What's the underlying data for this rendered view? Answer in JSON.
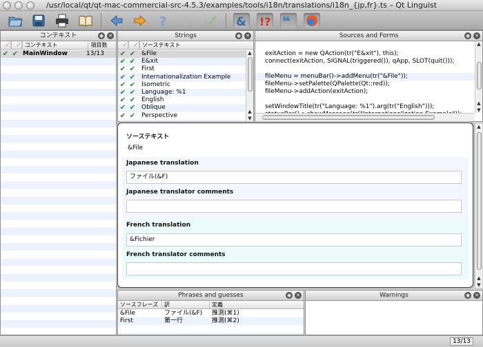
{
  "window": {
    "title": "/usr/local/qt/qt-mac-commercial-src-4.5.3/examples/tools/i18n/translations/i18n_{jp,fr}.ts – Qt Linguist"
  },
  "toolbar": {
    "icons": [
      "open-icon",
      "save-icon",
      "print-icon",
      "phrasebook-icon",
      "previous-icon",
      "next-icon",
      "prev-unfinished-icon",
      "next-unfinished-icon",
      "done-next-icon",
      "accelerators-icon",
      "ending-punctuation-icon",
      "phrase-matches-icon",
      "place-marker-icon"
    ]
  },
  "context_panel": {
    "title": "コンテキスト",
    "columns": [
      "",
      "コンテキスト",
      "項目数"
    ],
    "rows": [
      {
        "name": "MainWindow",
        "count": "13/13"
      }
    ]
  },
  "strings_panel": {
    "title": "Strings",
    "columns": [
      "",
      "ソーステキスト"
    ],
    "rows": [
      {
        "text": "&File",
        "selected": true
      },
      {
        "text": "E&xit"
      },
      {
        "text": "First"
      },
      {
        "text": "Internationalization Example"
      },
      {
        "text": "Isometric"
      },
      {
        "text": "Language: %1"
      },
      {
        "text": "English"
      },
      {
        "text": "Oblique"
      },
      {
        "text": "Perspective"
      }
    ]
  },
  "sources_panel": {
    "title": "Sources and Forms",
    "lines": [
      "exitAction = new QAction(tr(\"E&xit\"), this);",
      "connect(exitAction, SIGNAL(triggered()), qApp, SLOT(quit()));",
      "",
      "fileMenu = menuBar()->addMenu(tr(\"&File\"));",
      "fileMenu->setPalette(QPalette(Qt::red));",
      "fileMenu->addAction(exitAction);",
      "",
      "setWindowTitle(tr(\"Language: %1\").arg(tr(\"English\")));",
      "statusBar()->showMessage(tr(\"Internationalization Example\"));"
    ]
  },
  "editor": {
    "source_label": "ソーステキスト",
    "source_text": "&File",
    "ja_label": "Japanese translation",
    "ja_value": "ファイル(&F)",
    "ja_comments_label": "Japanese translator comments",
    "ja_comments_value": "",
    "fr_label": "French translation",
    "fr_value": "&Fichier",
    "fr_comments_label": "French translator comments",
    "fr_comments_value": ""
  },
  "phrases_panel": {
    "title": "Phrases and guesses",
    "columns": [
      "ソースフレーズ",
      "訳",
      "定義"
    ],
    "rows": [
      {
        "source": "&File",
        "translation": "ファイル(&F)",
        "definition": "推測(⌘1)"
      },
      {
        "source": "First",
        "translation": "第一行",
        "definition": "推測(⌘2)"
      }
    ]
  },
  "warnings_panel": {
    "title": "Warnings"
  },
  "status": {
    "count": "13/13"
  },
  "colors": {
    "check_green": "#1f8a2a",
    "stripe_blue": "#edf3fe",
    "ja_background": "#f4f6ff",
    "fr_background": "#ebfbfb"
  }
}
